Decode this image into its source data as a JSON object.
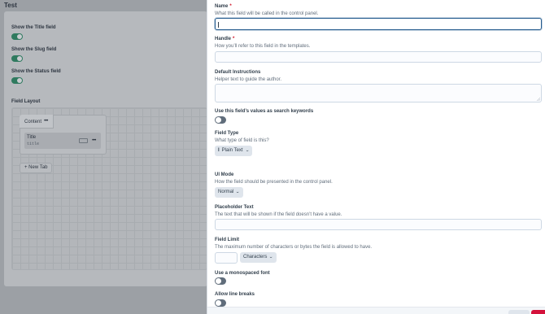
{
  "background": {
    "page_title": "Test",
    "toggles": [
      {
        "label": "Show the Title field",
        "on": true
      },
      {
        "label": "Show the Slug field",
        "on": true
      },
      {
        "label": "Show the Status field",
        "on": true
      }
    ],
    "field_layout_label": "Field Layout",
    "tab_name": "Content",
    "tab_menu": "•••",
    "field": {
      "name": "Title",
      "handle": "title",
      "menu": "•••"
    },
    "new_tab_label": "+ New Tab"
  },
  "slideout": {
    "name": {
      "label": "Name",
      "required": true,
      "instructions": "What this field will be called in the control panel.",
      "value": ""
    },
    "handle": {
      "label": "Handle",
      "required": true,
      "instructions": "How you’ll refer to this field in the templates.",
      "value": ""
    },
    "default_instructions": {
      "label": "Default Instructions",
      "instructions": "Helper text to guide the author.",
      "value": ""
    },
    "search_keywords": {
      "label": "Use this field’s values as search keywords",
      "on": false
    },
    "field_type": {
      "label": "Field Type",
      "instructions": "What type of field is this?",
      "value": "Plain Text",
      "icon": "text-cursor-icon",
      "icon_glyph": "I"
    },
    "ui_mode": {
      "label": "UI Mode",
      "instructions": "How the field should be presented in the control panel.",
      "value": "Normal"
    },
    "placeholder": {
      "label": "Placeholder Text",
      "instructions": "The text that will be shown if the field doesn’t have a value.",
      "value": ""
    },
    "field_limit": {
      "label": "Field Limit",
      "instructions": "The maximum number of characters or bytes the field is allowed to have.",
      "value": "",
      "unit": "Characters"
    },
    "monospaced": {
      "label": "Use a monospaced font",
      "on": false
    },
    "line_breaks": {
      "label": "Allow line breaks",
      "on": false
    },
    "required_marker": "*",
    "chevron": "⌄"
  },
  "colors": {
    "accent": "#245b8e",
    "required": "#cf1124",
    "toggle_on": "#2f7a5f",
    "save": "#d4123b"
  }
}
